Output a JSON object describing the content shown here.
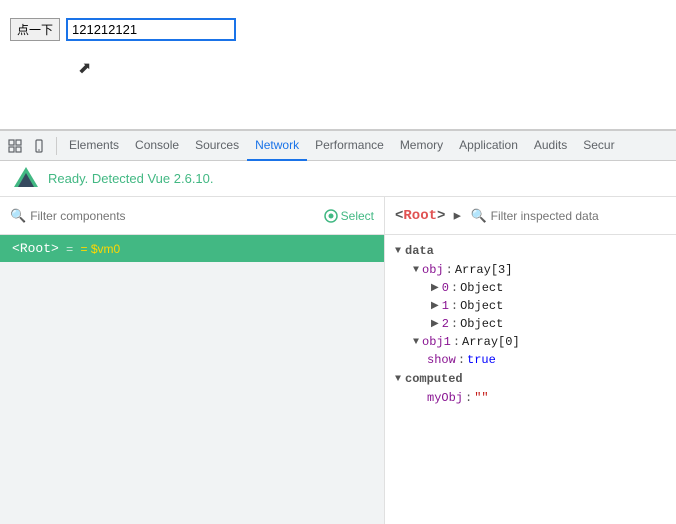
{
  "page": {
    "button_label": "点一下",
    "input_value": "121212121"
  },
  "devtools": {
    "tabs": [
      {
        "label": "Elements",
        "active": false
      },
      {
        "label": "Console",
        "active": false
      },
      {
        "label": "Sources",
        "active": false
      },
      {
        "label": "Network",
        "active": true
      },
      {
        "label": "Performance",
        "active": false
      },
      {
        "label": "Memory",
        "active": false
      },
      {
        "label": "Application",
        "active": false
      },
      {
        "label": "Audits",
        "active": false
      },
      {
        "label": "Secur",
        "active": false
      }
    ],
    "vue_status": "Ready. Detected Vue 2.6.10.",
    "filter_placeholder": "Filter components",
    "select_label": "Select",
    "root_tag": "<Root>",
    "root_vm": "= $vm0",
    "right_root_display": "Root",
    "filter_inspected_placeholder": "Filter inspected data",
    "sections": {
      "data": {
        "name": "data",
        "items": [
          {
            "key": "obj",
            "value": "Array[3]",
            "children": [
              {
                "key": "0",
                "value": "Object"
              },
              {
                "key": "1",
                "value": "Object"
              },
              {
                "key": "2",
                "value": "Object"
              }
            ]
          },
          {
            "key": "obj1",
            "value": "Array[0]"
          },
          {
            "key": "show",
            "value": "true",
            "type": "bool"
          }
        ]
      },
      "computed": {
        "name": "computed",
        "items": [
          {
            "key": "myObj",
            "value": "\"\"",
            "type": "string"
          }
        ]
      }
    }
  }
}
